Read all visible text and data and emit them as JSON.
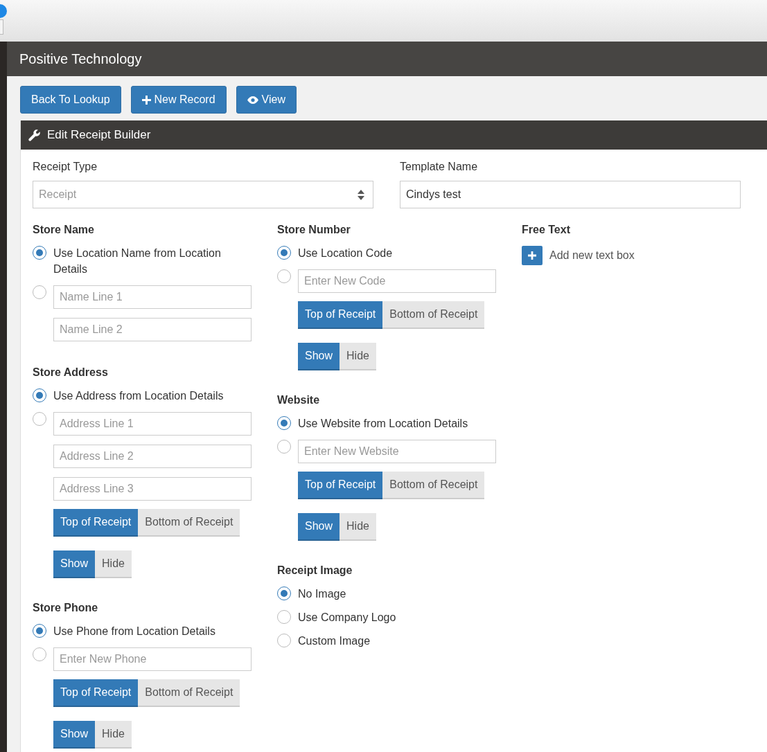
{
  "app_title": "Positive Technology",
  "toolbar": [
    {
      "label": "Back To Lookup",
      "kind": "plain"
    },
    {
      "label": "New Record",
      "kind": "add"
    },
    {
      "label": "View",
      "kind": "view"
    }
  ],
  "panel": {
    "title": "Edit Receipt Builder",
    "receipt_type": {
      "label": "Receipt Type",
      "placeholder": "Receipt"
    },
    "template_name": {
      "label": "Template Name",
      "value": "Cindys test"
    },
    "columns": [
      [
        {
          "title": "Store Name",
          "options": [
            {
              "kind": "label",
              "text": "Use Location Name from Location Details",
              "selected": true
            },
            {
              "kind": "fields",
              "selected": false,
              "fields": [
                {
                  "placeholder": "Name Line 1"
                },
                {
                  "placeholder": "Name Line 2"
                }
              ]
            }
          ]
        },
        {
          "title": "Store Address",
          "options": [
            {
              "kind": "label",
              "text": "Use Address from Location Details",
              "selected": true
            },
            {
              "kind": "fields",
              "selected": false,
              "fields": [
                {
                  "placeholder": "Address Line 1"
                },
                {
                  "placeholder": "Address Line 2"
                },
                {
                  "placeholder": "Address Line 3"
                }
              ]
            }
          ],
          "toggles": [
            [
              {
                "label": "Top of Receipt",
                "selected": true
              },
              {
                "label": "Bottom of Receipt",
                "selected": false
              }
            ],
            [
              {
                "label": "Show",
                "selected": true
              },
              {
                "label": "Hide",
                "selected": false
              }
            ]
          ]
        },
        {
          "title": "Store Phone",
          "options": [
            {
              "kind": "label",
              "text": "Use Phone from Location Details",
              "selected": true
            },
            {
              "kind": "fields",
              "selected": false,
              "fields": [
                {
                  "placeholder": "Enter New Phone"
                }
              ]
            }
          ],
          "toggles": [
            [
              {
                "label": "Top of Receipt",
                "selected": true
              },
              {
                "label": "Bottom of Receipt",
                "selected": false
              }
            ],
            [
              {
                "label": "Show",
                "selected": true
              },
              {
                "label": "Hide",
                "selected": false
              }
            ]
          ]
        }
      ],
      [
        {
          "title": "Store Number",
          "options": [
            {
              "kind": "label",
              "text": "Use Location Code",
              "selected": true
            },
            {
              "kind": "fields",
              "selected": false,
              "fields": [
                {
                  "placeholder": "Enter New Code"
                }
              ]
            }
          ],
          "toggles": [
            [
              {
                "label": "Top of Receipt",
                "selected": true
              },
              {
                "label": "Bottom of Receipt",
                "selected": false
              }
            ],
            [
              {
                "label": "Show",
                "selected": true
              },
              {
                "label": "Hide",
                "selected": false
              }
            ]
          ]
        },
        {
          "title": "Website",
          "options": [
            {
              "kind": "label",
              "text": "Use Website from Location Details",
              "selected": true
            },
            {
              "kind": "fields",
              "selected": false,
              "fields": [
                {
                  "placeholder": "Enter New Website"
                }
              ]
            }
          ],
          "toggles": [
            [
              {
                "label": "Top of Receipt",
                "selected": true
              },
              {
                "label": "Bottom of Receipt",
                "selected": false
              }
            ],
            [
              {
                "label": "Show",
                "selected": true
              },
              {
                "label": "Hide",
                "selected": false
              }
            ]
          ]
        },
        {
          "title": "Receipt Image",
          "options": [
            {
              "kind": "label",
              "text": "No Image",
              "selected": true
            },
            {
              "kind": "label",
              "text": "Use Company Logo",
              "selected": false
            },
            {
              "kind": "label",
              "text": "Custom Image",
              "selected": false
            }
          ]
        }
      ],
      [
        {
          "title": "Free Text",
          "add_label": "Add new text box"
        }
      ]
    ]
  }
}
